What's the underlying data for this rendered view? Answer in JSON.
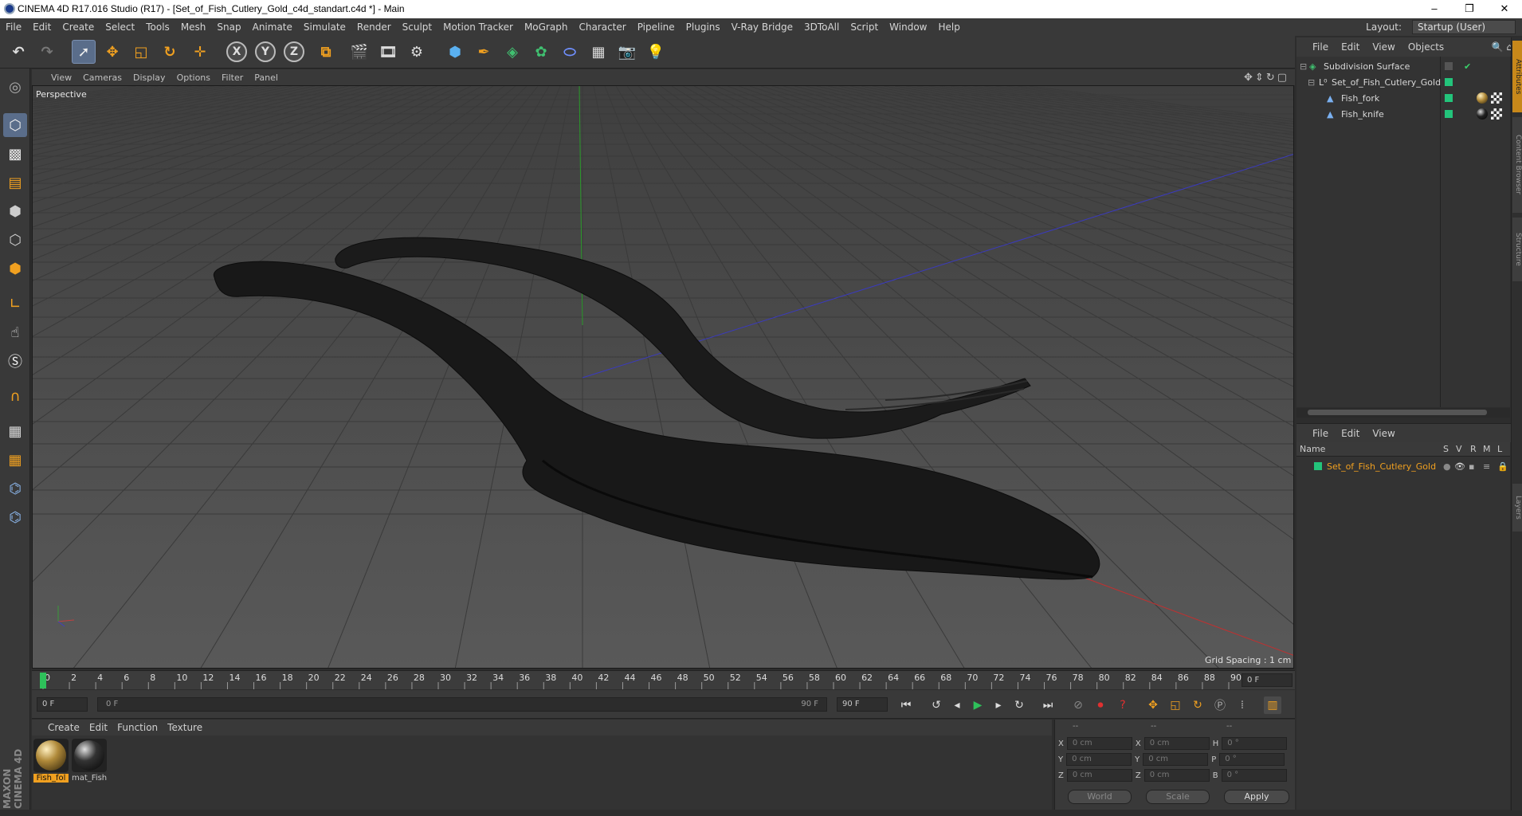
{
  "window": {
    "title": "CINEMA 4D R17.016 Studio (R17) - [Set_of_Fish_Cutlery_Gold_c4d_standart.c4d *] - Main",
    "minimize": "–",
    "maximize": "❐",
    "close": "✕"
  },
  "menu": [
    "File",
    "Edit",
    "Create",
    "Select",
    "Tools",
    "Mesh",
    "Snap",
    "Animate",
    "Simulate",
    "Render",
    "Sculpt",
    "Motion Tracker",
    "MoGraph",
    "Character",
    "Pipeline",
    "Plugins",
    "V-Ray Bridge",
    "3DToAll",
    "Script",
    "Window",
    "Help"
  ],
  "layout": {
    "label": "Layout:",
    "value": "Startup (User)"
  },
  "toolbar": {
    "axis_x": "X",
    "axis_y": "Y",
    "axis_z": "Z"
  },
  "viewport": {
    "menu": [
      "View",
      "Cameras",
      "Display",
      "Options",
      "Filter",
      "Panel"
    ],
    "label": "Perspective",
    "grid_spacing": "Grid Spacing : 1 cm"
  },
  "timeline": {
    "ticks": [
      "0",
      "2",
      "4",
      "6",
      "8",
      "10",
      "12",
      "14",
      "16",
      "18",
      "20",
      "22",
      "24",
      "26",
      "28",
      "30",
      "32",
      "34",
      "36",
      "38",
      "40",
      "42",
      "44",
      "46",
      "48",
      "50",
      "52",
      "54",
      "56",
      "58",
      "60",
      "62",
      "64",
      "66",
      "68",
      "70",
      "72",
      "74",
      "76",
      "78",
      "80",
      "82",
      "84",
      "86",
      "88",
      "90"
    ],
    "current_frame": "0 F",
    "start_field": "0 F",
    "range_start": "0 F",
    "range_end": "90 F",
    "end_field": "90 F"
  },
  "material_manager": {
    "menu": [
      "Create",
      "Edit",
      "Function",
      "Texture"
    ],
    "materials": [
      {
        "name": "Fish_fol",
        "selected": true,
        "color": "#b08a3a"
      },
      {
        "name": "mat_Fish",
        "selected": false,
        "color": "#2a2a2a"
      }
    ]
  },
  "coordinates": {
    "header": [
      "--",
      "--",
      "--"
    ],
    "rows": [
      {
        "a": "X",
        "av": "0 cm",
        "b": "X",
        "bv": "0 cm",
        "c": "H",
        "cv": "0 °"
      },
      {
        "a": "Y",
        "av": "0 cm",
        "b": "Y",
        "bv": "0 cm",
        "c": "P",
        "cv": "0 °"
      },
      {
        "a": "Z",
        "av": "0 cm",
        "b": "Z",
        "bv": "0 cm",
        "c": "B",
        "cv": "0 °"
      }
    ],
    "world": "World",
    "scale": "Scale",
    "apply": "Apply"
  },
  "object_manager": {
    "menu": [
      "File",
      "Edit",
      "View",
      "Objects"
    ],
    "objects": [
      {
        "name": "Subdivision Surface",
        "indent": 0
      },
      {
        "name": "Set_of_Fish_Cutlery_Gold",
        "indent": 1
      },
      {
        "name": "Fish_fork",
        "indent": 2
      },
      {
        "name": "Fish_knife",
        "indent": 2
      }
    ]
  },
  "attribute_manager": {
    "menu": [
      "File",
      "Edit",
      "View"
    ],
    "columns": {
      "name": "Name",
      "s": "S",
      "v": "V",
      "r": "R",
      "m": "M",
      "l": "L"
    },
    "layer": "Set_of_Fish_Cutlery_Gold"
  },
  "branding": "MAXON CINEMA 4D",
  "side_tabs": [
    "Attributes",
    "Content Browser",
    "Structure",
    "Layers"
  ]
}
